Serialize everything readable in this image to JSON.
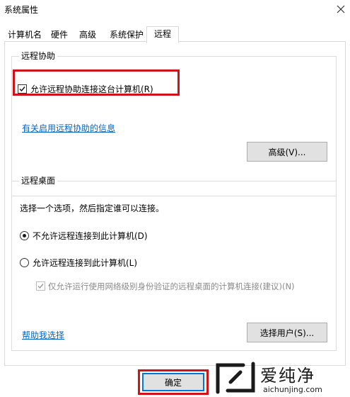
{
  "window": {
    "title": "系统属性"
  },
  "tabs": [
    {
      "label": "计算机名"
    },
    {
      "label": "硬件"
    },
    {
      "label": "高级"
    },
    {
      "label": "系统保护"
    },
    {
      "label": "远程"
    }
  ],
  "remote_assistance": {
    "group_title": "远程协助",
    "allow_checkbox_label": "允许远程协助连接这台计算机(R)",
    "allow_checked": true,
    "info_link": "有关启用远程协助的信息",
    "advanced_button": "高级(V)..."
  },
  "remote_desktop": {
    "group_title": "远程桌面",
    "instruction": "选择一个选项，然后指定谁可以连接。",
    "option_deny": "不允许远程连接到此计算机(D)",
    "option_allow": "允许远程连接到此计算机(L)",
    "nla_checkbox_label": "仅允许运行使用网络级别身份验证的远程桌面的计算机连接(建议)(N)",
    "help_link": "帮助我选择",
    "select_users_button": "选择用户(S)..."
  },
  "footer": {
    "ok_button": "确定"
  },
  "watermark": {
    "brand": "爱纯净",
    "domain": "aichunjing.com"
  },
  "colors": {
    "highlight": "#d0121b",
    "link": "#0066cc"
  }
}
